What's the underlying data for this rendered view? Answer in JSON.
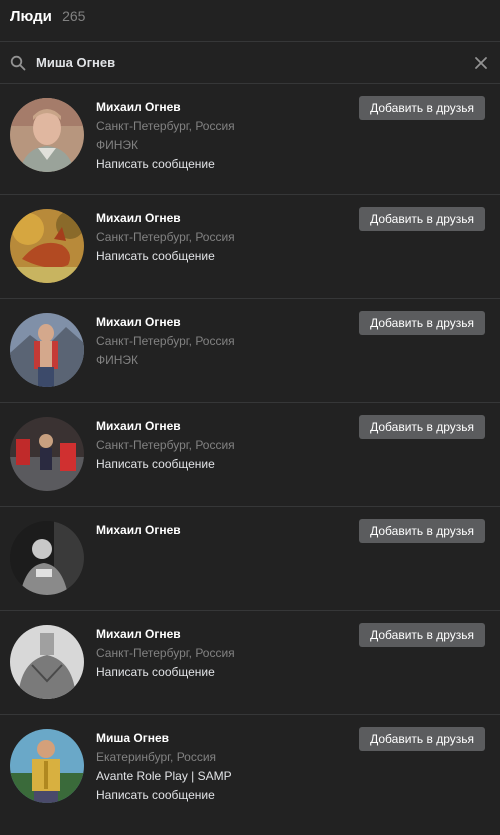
{
  "header": {
    "title": "Люди",
    "count": "265"
  },
  "search": {
    "value": "Миша Огнев"
  },
  "icons": {
    "search": "search-icon",
    "close": "close-icon"
  },
  "colors": {
    "background": "#222222",
    "button": "#5b5c5e",
    "divider": "#363738"
  },
  "people": [
    {
      "name": "Михаил Огнев",
      "location": "Санкт-Петербург, Россия",
      "extra": "ФИНЭК",
      "message": "Написать сообщение",
      "add": "Добавить в друзья"
    },
    {
      "name": "Михаил Огнев",
      "location": "Санкт-Петербург, Россия",
      "message": "Написать сообщение",
      "add": "Добавить в друзья"
    },
    {
      "name": "Михаил Огнев",
      "location": "Санкт-Петербург, Россия",
      "extra": "ФИНЭК",
      "add": "Добавить в друзья"
    },
    {
      "name": "Михаил Огнев",
      "location": "Санкт-Петербург, Россия",
      "message": "Написать сообщение",
      "add": "Добавить в друзья"
    },
    {
      "name": "Михаил Огнев",
      "add": "Добавить в друзья"
    },
    {
      "name": "Михаил Огнев",
      "location": "Санкт-Петербург, Россия",
      "message": "Написать сообщение",
      "add": "Добавить в друзья"
    },
    {
      "name": "Миша Огнев",
      "location": "Екатеринбург, Россия",
      "group": "Avante Role Play | SAMP",
      "message": "Написать сообщение",
      "add": "Добавить в друзья"
    }
  ]
}
